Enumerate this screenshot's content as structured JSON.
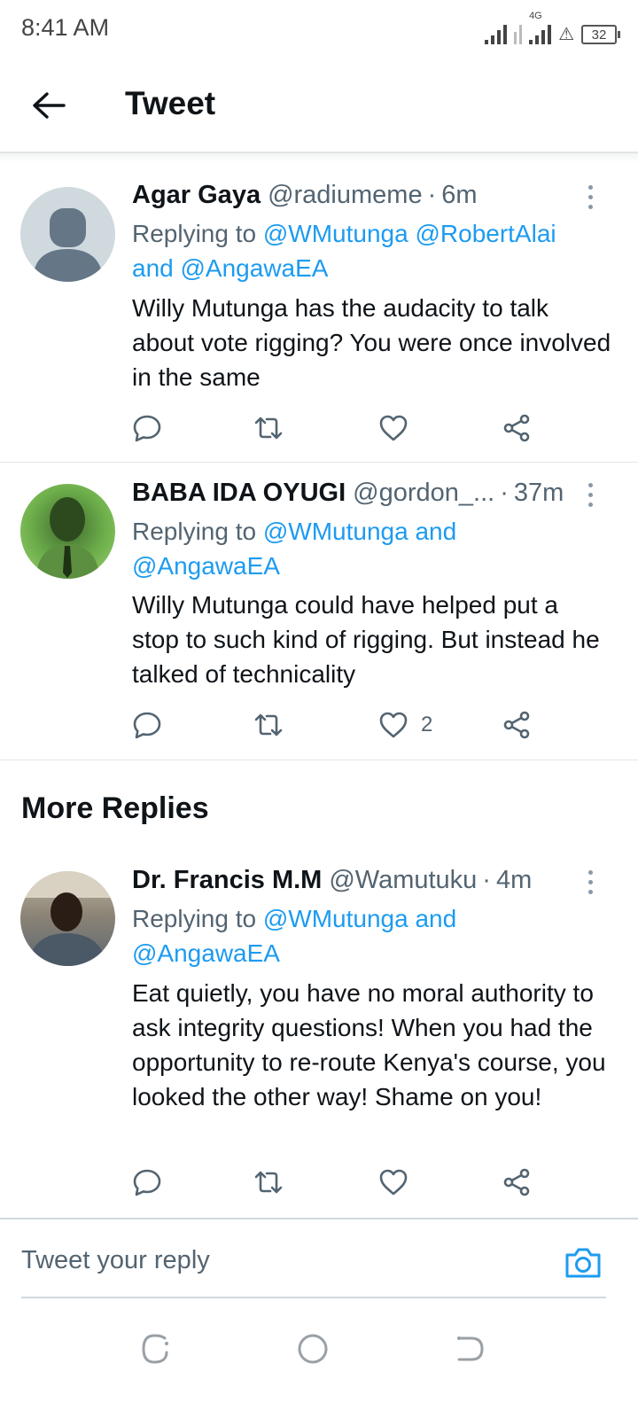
{
  "status": {
    "time": "8:41 AM",
    "network": "4G",
    "battery": "32"
  },
  "header": {
    "title": "Tweet"
  },
  "tweets": [
    {
      "author": "Agar Gaya",
      "handle": "@radiumeme",
      "separator": "·",
      "time": "6m",
      "replying_prefix": "Replying to",
      "replying_links": "@WMutunga @RobertAlai and @AngawaEA",
      "text": "Willy Mutunga has the audacity to talk about vote rigging?  You were once involved in the same",
      "likes": ""
    },
    {
      "author": "BABA IDA OYUGI",
      "handle": "@gordon_...",
      "separator": "·",
      "time": "37m",
      "replying_prefix": "Replying to",
      "replying_links": "@WMutunga and @AngawaEA",
      "text": "Willy Mutunga could have helped put a stop to such kind of rigging. But instead he talked of technicality",
      "likes": "2"
    },
    {
      "author": "Dr. Francis M.M",
      "handle": "@Wamutuku",
      "separator": "·",
      "time": "4m",
      "replying_prefix": "Replying to",
      "replying_links": "@WMutunga and @AngawaEA",
      "text": "Eat quietly, you have no moral authority to ask integrity questions! When you had the opportunity to re-route Kenya's course, you looked the other way! Shame on you!",
      "likes": ""
    }
  ],
  "more_replies": {
    "title": "More Replies"
  },
  "composer": {
    "placeholder": "Tweet your reply"
  },
  "colors": {
    "link": "#1d9bf0",
    "secondary": "#536471",
    "text": "#0f1419"
  },
  "icons": {
    "back": "arrow-left-icon",
    "reply": "reply-icon",
    "retweet": "retweet-icon",
    "like": "heart-icon",
    "share": "share-icon",
    "more": "more-vertical-icon",
    "camera": "camera-icon"
  }
}
